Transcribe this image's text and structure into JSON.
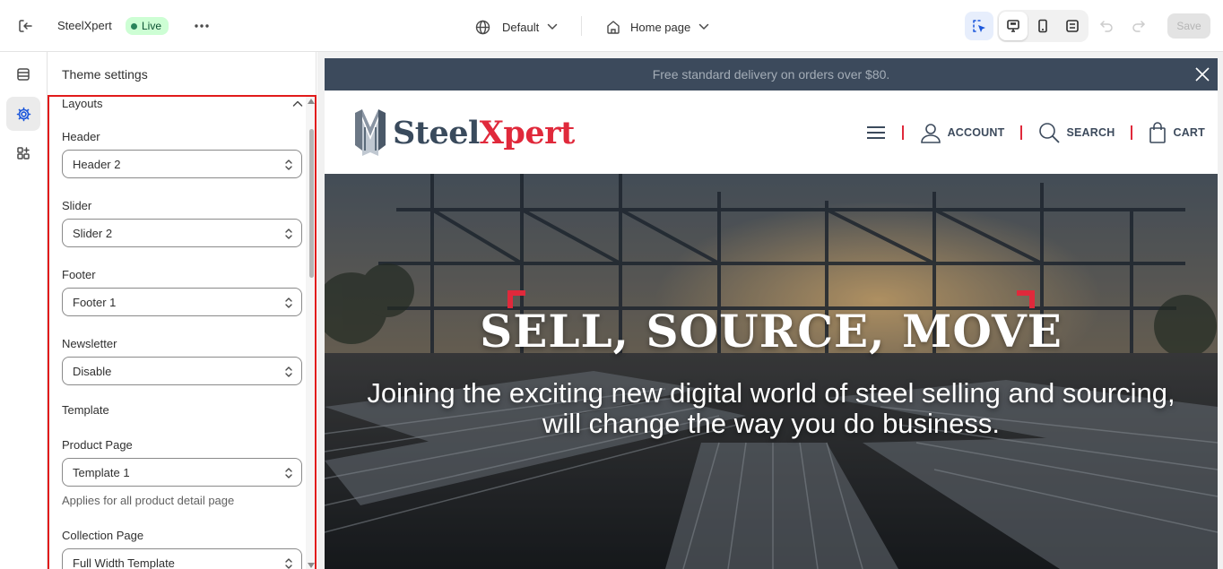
{
  "topbar": {
    "store_name": "SteelXpert",
    "live_badge": "Live",
    "theme_selector": "Default",
    "page_selector": "Home page",
    "save_label": "Save"
  },
  "panel": {
    "title": "Theme settings",
    "section_layouts": "Layouts",
    "header_label": "Header",
    "header_value": "Header 2",
    "slider_label": "Slider",
    "slider_value": "Slider 2",
    "footer_label": "Footer",
    "footer_value": "Footer 1",
    "newsletter_label": "Newsletter",
    "newsletter_value": "Disable",
    "section_template": "Template",
    "product_page_label": "Product Page",
    "product_page_value": "Template 1",
    "product_page_hint": "Applies for all product detail page",
    "collection_page_label": "Collection Page",
    "collection_page_value": "Full Width Template"
  },
  "preview": {
    "announcement": "Free standard delivery on orders over $80.",
    "logo_part1": "Steel",
    "logo_part2": "Xpert",
    "nav_account": "ACCOUNT",
    "nav_search": "SEARCH",
    "nav_cart": "CART",
    "hero_title": "SELL, SOURCE, MOVE",
    "hero_subtitle_line1": "Joining the exciting new digital world of steel selling and sourcing,",
    "hero_subtitle_line2": "will change the way you do business."
  },
  "colors": {
    "highlight_border": "#e11b1b",
    "announce_bg": "#3c4a5c",
    "brand_red": "#e0293b",
    "brand_navy": "#394a5c",
    "live_badge_bg": "#cdfed4"
  },
  "icons": [
    "exit-icon",
    "more-icon",
    "globe-icon",
    "home-icon",
    "chevron-down-icon",
    "inspect-icon",
    "desktop-icon",
    "mobile-icon",
    "fullscreen-icon",
    "undo-icon",
    "redo-icon",
    "sections-icon",
    "settings-gear-icon",
    "apps-icon",
    "select-chevron-icon",
    "close-icon",
    "hamburger-icon",
    "user-icon",
    "search-icon",
    "bag-icon"
  ]
}
